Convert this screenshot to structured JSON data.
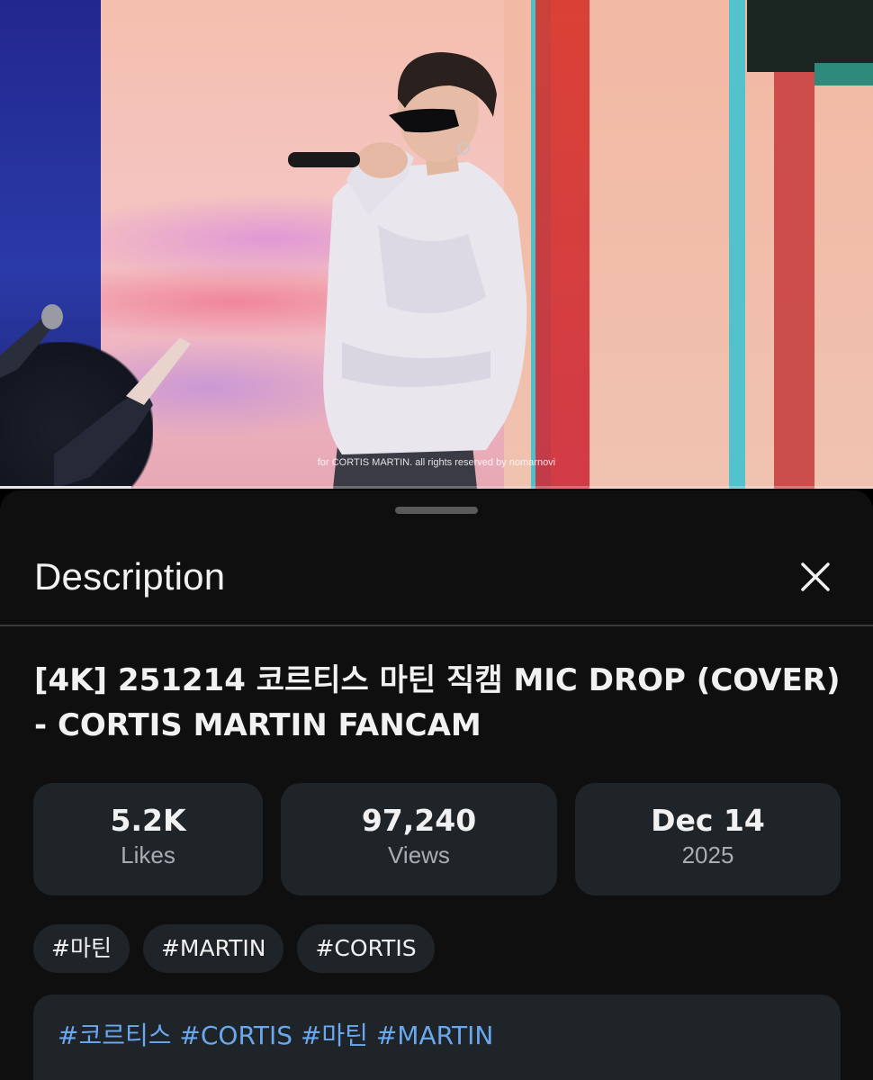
{
  "video": {
    "watermark": "for CORTIS MARTIN. all rights reserved by nomarnovi",
    "progress": 0.15
  },
  "sheet": {
    "title": "Description",
    "close_icon": "close-icon"
  },
  "video_title": "[4K] 251214 코르티스 마틴 직캠 MIC DROP (COVER) - CORTIS MARTIN FANCAM",
  "stats": {
    "likes_value": "5.2K",
    "likes_label": "Likes",
    "views_value": "97,240",
    "views_label": "Views",
    "date_value": "Dec 14",
    "date_year": "2025"
  },
  "tags": [
    "#마틴",
    "#MARTIN",
    "#CORTIS"
  ],
  "description": {
    "hashtags": [
      "#코르티스",
      "#CORTIS",
      "#마틴",
      "#MARTIN"
    ]
  },
  "colors": {
    "sheet_bg": "#0f0f0f",
    "card_bg": "#1f2429",
    "link": "#6aa8ee"
  }
}
